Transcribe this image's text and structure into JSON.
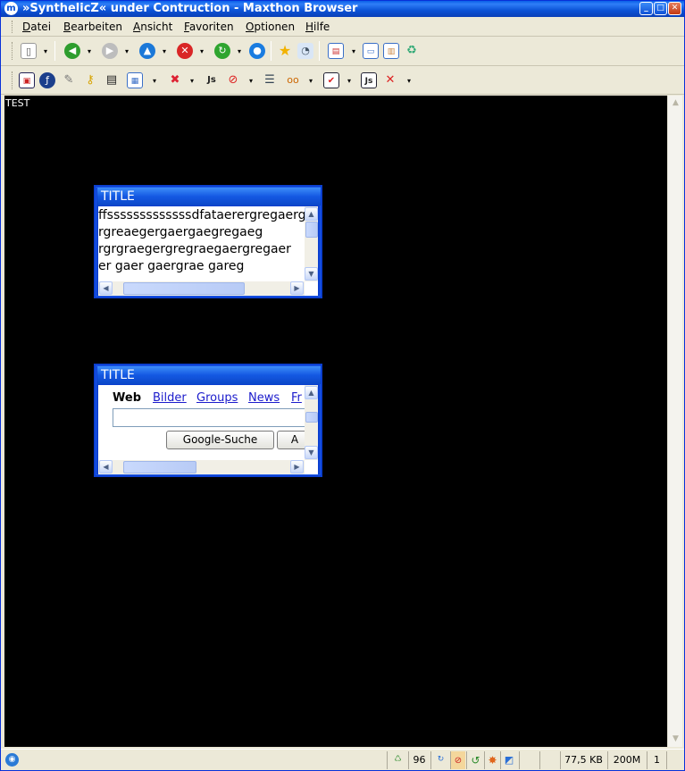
{
  "window": {
    "title": "»SynthelicZ« under Contruction - Maxthon Browser",
    "app_icon": "m"
  },
  "menu": [
    "Datei",
    "Bearbeiten",
    "Ansicht",
    "Favoriten",
    "Optionen",
    "Hilfe"
  ],
  "page": {
    "text": "TEST",
    "background": "#000000"
  },
  "popup1": {
    "title": "TITLE",
    "lines": [
      "ffsssssssssssssdfataerergregaerg",
      "rgreaegergaergaegregaeg",
      "rgrgraegergregraegaergregaer",
      "er gaer gaergrae gareg"
    ]
  },
  "popup2": {
    "title": "TITLE",
    "tabs": [
      "Web",
      "Bilder",
      "Groups",
      "News",
      "Fr"
    ],
    "search_value": "",
    "search_button": "Google-Suche",
    "second_button": "A"
  },
  "status": {
    "num1": "96",
    "size": "77,5 KB",
    "memory": "200M",
    "count": "1"
  },
  "colors": {
    "titlebar": "#0b52d6",
    "chrome": "#ece9d8",
    "link": "#1c1ccc"
  }
}
